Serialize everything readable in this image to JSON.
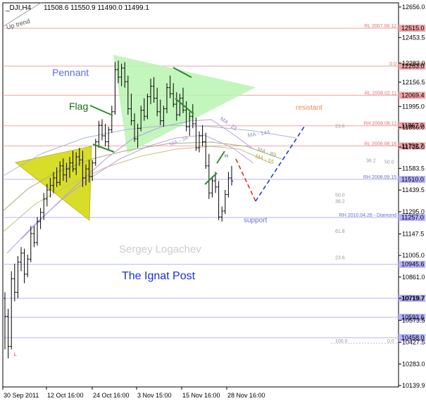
{
  "header": {
    "symbol": "_DJI,H4",
    "ohlc": "11508.6 11550.9 11490.0 11499.1"
  },
  "labels": {
    "uptrend": "Up trend",
    "pennant": "Pennant",
    "flag": "Flag",
    "resistant": "resistant",
    "support": "support",
    "author": "Sergey Logachev",
    "brand": "The Ignat Post",
    "ma21": "MA - 21",
    "ma144": "MA - 144",
    "ma89": "MA - 89",
    "ma55": "MA - 55",
    "ma34": "MA - 34",
    "h": "H",
    "l": "L"
  },
  "colors": {
    "pennant_fill": "#b8f5b0",
    "flag_fill": "#d6dc1e",
    "candle": "#000000",
    "flag_stroke": "#2e8b2e",
    "resistant_dash": "#1a2fd6",
    "drop_dash": "#e0241c",
    "hline_red": "#f2a3a3",
    "hline_blue": "#b3b3ff",
    "ma21": "#b39ddb",
    "ma34": "#c0a0e0",
    "ma55": "#c8c080",
    "ma89": "#a0b080",
    "ma144": "#a8b8d0"
  },
  "chart_data": {
    "type": "candlestick",
    "timeframe": "H4",
    "ylim": [
      10139.9,
      12656.0
    ],
    "y_ticks": [
      "12656.0",
      "12453.5",
      "12283.0",
      "12156.5",
      "11995.0",
      "11856.0",
      "11725.0",
      "11583.5",
      "11439.5",
      "11295.0",
      "11147.5",
      "11005.0",
      "10861.0",
      "10719.7",
      "10573.5",
      "10427.5",
      "10283.0",
      "10139.9"
    ],
    "x_ticks": [
      "30 Sep 2011",
      "12 Oct 16:00",
      "24 Oct 16:00",
      "3 Nov 15:00",
      "15 Nov 16:00",
      "28 Nov 16:00"
    ],
    "levels": [
      {
        "label": "RL 2007.08.12",
        "value": 12515.0,
        "tag": "12515.0",
        "kind": "red"
      },
      {
        "label": "0.0",
        "value": 12263.0,
        "tag": "12263.0",
        "kind": "red"
      },
      {
        "label": "RL 2008.02.11",
        "value": 12069.4,
        "tag": "12069.4",
        "kind": "red"
      },
      {
        "label": "RH 2008.08.11",
        "value": 11867.0,
        "tag": "11867.0",
        "kind": "red"
      },
      {
        "label": "RL 2008.08.18",
        "value": 11732.7,
        "tag": "11732.7",
        "kind": "red"
      },
      {
        "label": "RH 2008.09.15",
        "value": 11510.0,
        "tag": "11510.0",
        "kind": "blue"
      },
      {
        "label": "RH 2010.04.26 - Diamond",
        "value": 11257.0,
        "tag": "11257.0",
        "kind": "blue"
      },
      {
        "label": "",
        "value": 10945.6,
        "tag": "10945.6",
        "kind": "blue"
      },
      {
        "label": "",
        "value": 10719.7,
        "tag": "10719.7",
        "kind": "blue"
      },
      {
        "label": "",
        "value": 10593.6,
        "tag": "10593.6",
        "kind": "blue"
      },
      {
        "label": "",
        "value": 10458.0,
        "tag": "10458.0",
        "kind": "blue"
      }
    ],
    "fib": [
      {
        "label": "23.6",
        "value": 11850
      },
      {
        "label": "38.2",
        "value": 11620
      },
      {
        "label": "50.0",
        "value": 11610
      },
      {
        "label": "50.0",
        "value": 11390
      },
      {
        "label": "38.2",
        "value": 11350
      },
      {
        "label": "61.8",
        "value": 11150
      },
      {
        "label": "23.6",
        "value": 10975
      },
      {
        "label": "100.0",
        "value": 10420
      },
      {
        "label": "0.0",
        "value": 10420
      }
    ],
    "candles": [
      [
        10720,
        10760,
        10380,
        10600
      ],
      [
        10600,
        10650,
        10320,
        10400
      ],
      [
        10400,
        10900,
        10380,
        10850
      ],
      [
        10850,
        10950,
        10700,
        10760
      ],
      [
        10760,
        11000,
        10720,
        10960
      ],
      [
        10960,
        11060,
        10900,
        11020
      ],
      [
        11020,
        11050,
        10820,
        10880
      ],
      [
        10880,
        11010,
        10860,
        10980
      ],
      [
        10980,
        11200,
        10960,
        11150
      ],
      [
        11150,
        11200,
        11060,
        11090
      ],
      [
        11090,
        11260,
        11070,
        11230
      ],
      [
        11230,
        11320,
        11180,
        11290
      ],
      [
        11290,
        11420,
        11240,
        11380
      ],
      [
        11380,
        11480,
        11330,
        11440
      ],
      [
        11440,
        11520,
        11390,
        11470
      ],
      [
        11470,
        11560,
        11420,
        11520
      ],
      [
        11520,
        11590,
        11460,
        11490
      ],
      [
        11490,
        11630,
        11470,
        11600
      ],
      [
        11600,
        11650,
        11500,
        11540
      ],
      [
        11540,
        11620,
        11490,
        11580
      ],
      [
        11580,
        11660,
        11520,
        11620
      ],
      [
        11620,
        11700,
        11560,
        11580
      ],
      [
        11580,
        11690,
        11540,
        11660
      ],
      [
        11660,
        11720,
        11600,
        11640
      ],
      [
        11640,
        11700,
        11460,
        11520
      ],
      [
        11520,
        11610,
        11470,
        11580
      ],
      [
        11580,
        11640,
        11490,
        11530
      ],
      [
        11530,
        11640,
        11500,
        11620
      ],
      [
        11620,
        11780,
        11600,
        11760
      ],
      [
        11760,
        11900,
        11720,
        11870
      ],
      [
        11870,
        11910,
        11770,
        11800
      ],
      [
        11800,
        11880,
        11730,
        11760
      ],
      [
        11760,
        11860,
        11700,
        11840
      ],
      [
        11840,
        12000,
        11820,
        11960
      ],
      [
        11960,
        12290,
        11940,
        12240
      ],
      [
        12240,
        12300,
        12150,
        12190
      ],
      [
        12190,
        12280,
        12130,
        12250
      ],
      [
        12250,
        12290,
        12120,
        12160
      ],
      [
        12160,
        12200,
        11940,
        11980
      ],
      [
        11980,
        12080,
        11870,
        11900
      ],
      [
        11900,
        11950,
        11760,
        11780
      ],
      [
        11780,
        11880,
        11720,
        11850
      ],
      [
        11850,
        12000,
        11830,
        11970
      ],
      [
        11970,
        12050,
        11900,
        11930
      ],
      [
        11930,
        12080,
        11910,
        12060
      ],
      [
        12060,
        12180,
        12010,
        12130
      ],
      [
        12130,
        12190,
        12020,
        12050
      ],
      [
        12050,
        12120,
        11930,
        11960
      ],
      [
        11960,
        12040,
        11870,
        11900
      ],
      [
        11900,
        12000,
        11860,
        11980
      ],
      [
        11980,
        12150,
        11950,
        12120
      ],
      [
        12120,
        12200,
        12050,
        12080
      ],
      [
        12080,
        12150,
        11990,
        12010
      ],
      [
        12010,
        12090,
        11900,
        11940
      ],
      [
        11940,
        12080,
        11930,
        12050
      ],
      [
        12050,
        12120,
        11950,
        11970
      ],
      [
        11970,
        12030,
        11830,
        11860
      ],
      [
        11860,
        11960,
        11800,
        11930
      ],
      [
        11930,
        12010,
        11850,
        11880
      ],
      [
        11880,
        11920,
        11700,
        11720
      ],
      [
        11720,
        11830,
        11690,
        11800
      ],
      [
        11800,
        11870,
        11730,
        11760
      ],
      [
        11760,
        11820,
        11580,
        11600
      ],
      [
        11600,
        11680,
        11380,
        11420
      ],
      [
        11420,
        11530,
        11390,
        11500
      ],
      [
        11500,
        11560,
        11420,
        11460
      ],
      [
        11460,
        11500,
        11240,
        11260
      ],
      [
        11260,
        11330,
        11230,
        11300
      ],
      [
        11300,
        11440,
        11280,
        11410
      ],
      [
        11410,
        11560,
        11390,
        11520
      ],
      [
        11520,
        11600,
        11470,
        11499
      ]
    ]
  }
}
